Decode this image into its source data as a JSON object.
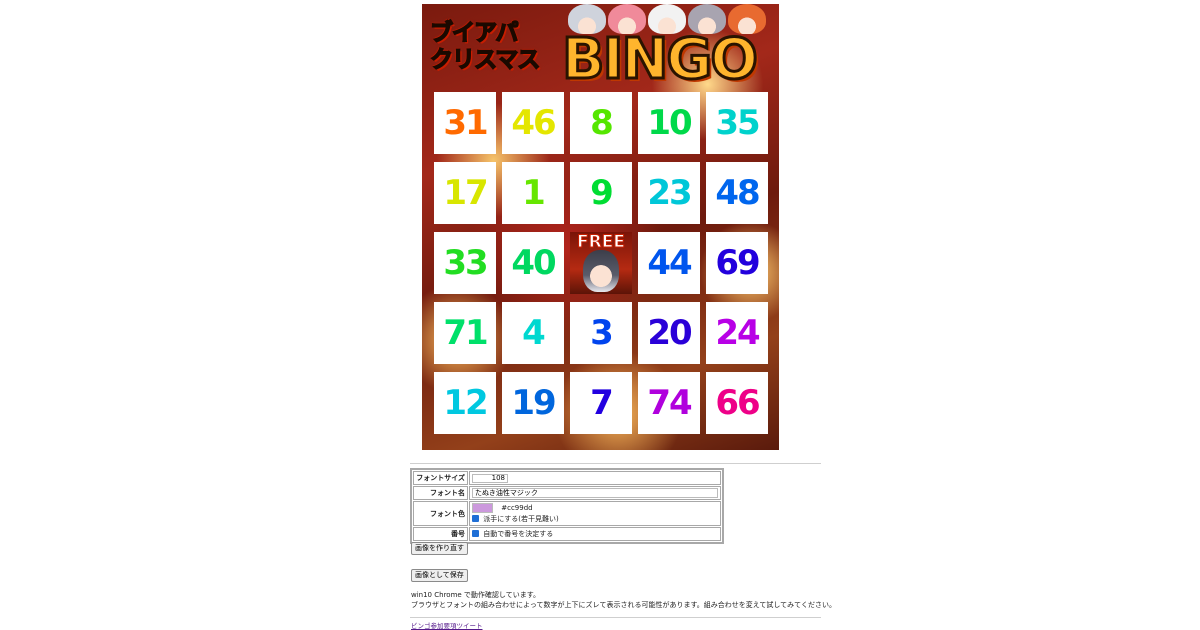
{
  "card": {
    "title_line1": "ブイアパ",
    "title_line2": "クリスマス",
    "bingo_word": "BINGO",
    "free_label": "FREE",
    "numbers": [
      [
        31,
        46,
        8,
        10,
        35
      ],
      [
        17,
        1,
        9,
        23,
        48
      ],
      [
        33,
        40,
        "FREE",
        44,
        69
      ],
      [
        71,
        4,
        3,
        20,
        24
      ],
      [
        12,
        19,
        7,
        74,
        66
      ]
    ],
    "number_colors": [
      [
        "#ff6a00",
        "#e4e600",
        "#55e600",
        "#00d94a",
        "#00d2cc"
      ],
      [
        "#d8e600",
        "#66e600",
        "#00dd33",
        "#00c7d8",
        "#0066ee"
      ],
      [
        "#22dd22",
        "#00d860",
        "",
        "#0055ee",
        "#2200dd"
      ],
      [
        "#00e06a",
        "#00d8d0",
        "#0044ee",
        "#2a00d8",
        "#b800e6"
      ],
      [
        "#00c8e0",
        "#0066dd",
        "#2200e0",
        "#b000dd",
        "#ee0088"
      ]
    ],
    "avatar_colors": [
      "#cfd3dc",
      "#f08a9a",
      "#f2f2f2",
      "#a8a4b0",
      "#e86a30"
    ]
  },
  "settings": {
    "font_size_label": "フォントサイズ",
    "font_size_value": "108",
    "font_name_label": "フォント名",
    "font_name_value": "たぬき油性マジック",
    "font_color_label": "フォント色",
    "font_color_hex": "#cc99dd",
    "rainbow_checkbox_label": "派手にする(若干見難い)",
    "number_label": "番号",
    "auto_number_checkbox_label": "自動で番号を決定する"
  },
  "buttons": {
    "regenerate": "画像を作り直す",
    "save_image": "画像として保存"
  },
  "notes": {
    "line1": "win10 Chrome で動作確認しています。",
    "line2": "ブラウザとフォントの組み合わせによって数字が上下にズレて表示される可能性があります。組み合わせを変えて試してみてください。"
  },
  "tweet_link": "ビンゴ参加要項ツイート"
}
